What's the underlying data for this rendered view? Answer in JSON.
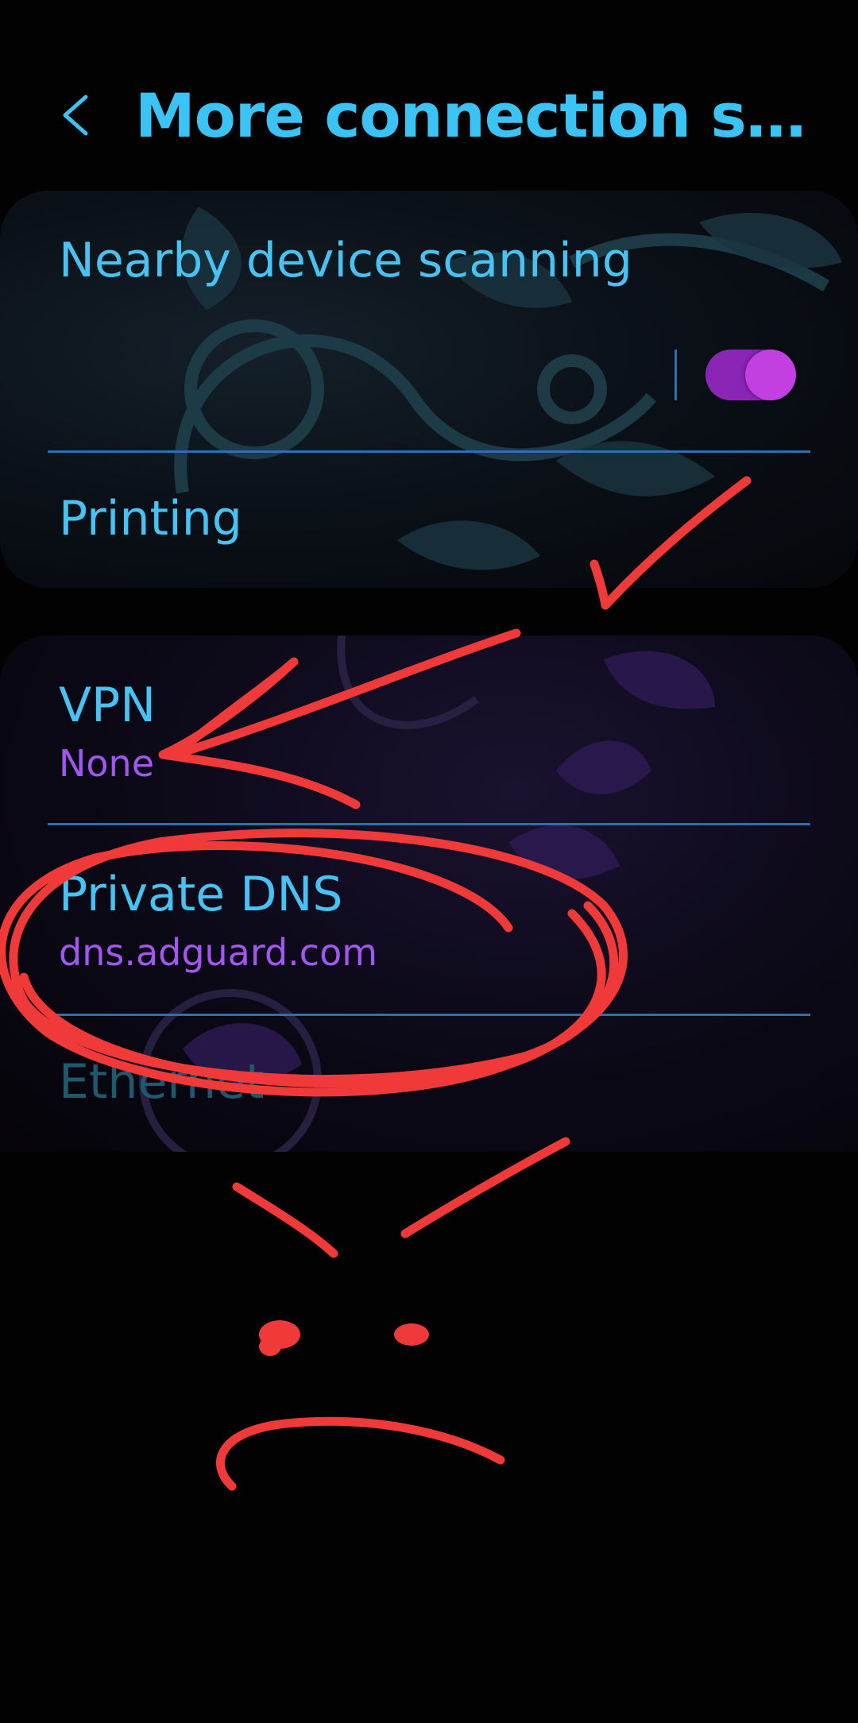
{
  "header": {
    "title": "More connection settin...",
    "back_icon": "chevron-left-icon"
  },
  "section_1": {
    "items": [
      {
        "label": "Nearby device scanning",
        "toggle_on": true
      },
      {
        "label": "Printing"
      }
    ]
  },
  "section_2": {
    "items": [
      {
        "label": "VPN",
        "value": "None"
      },
      {
        "label": "Private DNS",
        "value": "dns.adguard.com"
      },
      {
        "label": "Ethernet"
      }
    ]
  },
  "colors": {
    "accent_text": "#46c3f2",
    "value_text": "#a357f0",
    "toggle_track": "#8a25b6",
    "toggle_knob": "#c23fe0",
    "divider": "#2f6fae",
    "annotation": "#f03a3a"
  }
}
